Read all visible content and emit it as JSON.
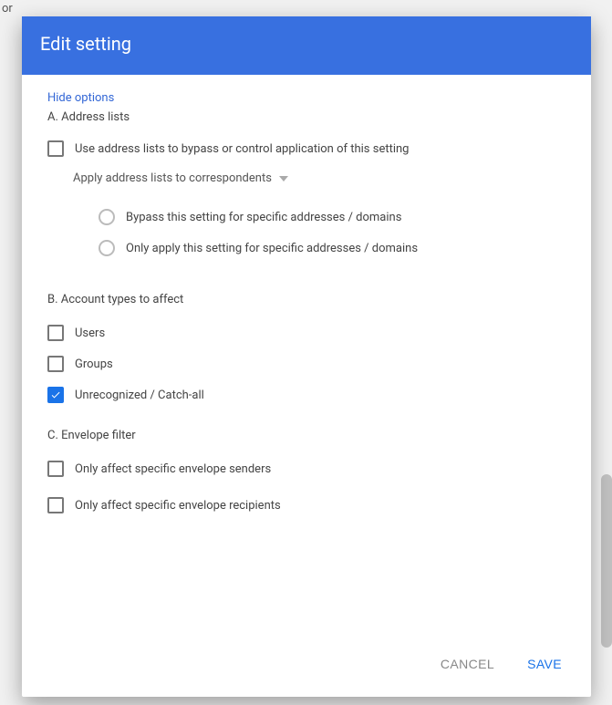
{
  "dialog": {
    "title": "Edit setting",
    "hide_options": "Hide options"
  },
  "section_a": {
    "heading": "A. Address lists",
    "use_address_lists": "Use address lists to bypass or control application of this setting",
    "dropdown_label": "Apply address lists to correspondents",
    "radio_bypass": "Bypass this setting for specific addresses / domains",
    "radio_only_apply": "Only apply this setting for specific addresses / domains"
  },
  "section_b": {
    "heading": "B. Account types to affect",
    "users": "Users",
    "groups": "Groups",
    "unrecognized": "Unrecognized / Catch-all"
  },
  "section_c": {
    "heading": "C. Envelope filter",
    "senders": "Only affect specific envelope senders",
    "recipients": "Only affect specific envelope recipients"
  },
  "footer": {
    "cancel": "CANCEL",
    "save": "SAVE"
  }
}
